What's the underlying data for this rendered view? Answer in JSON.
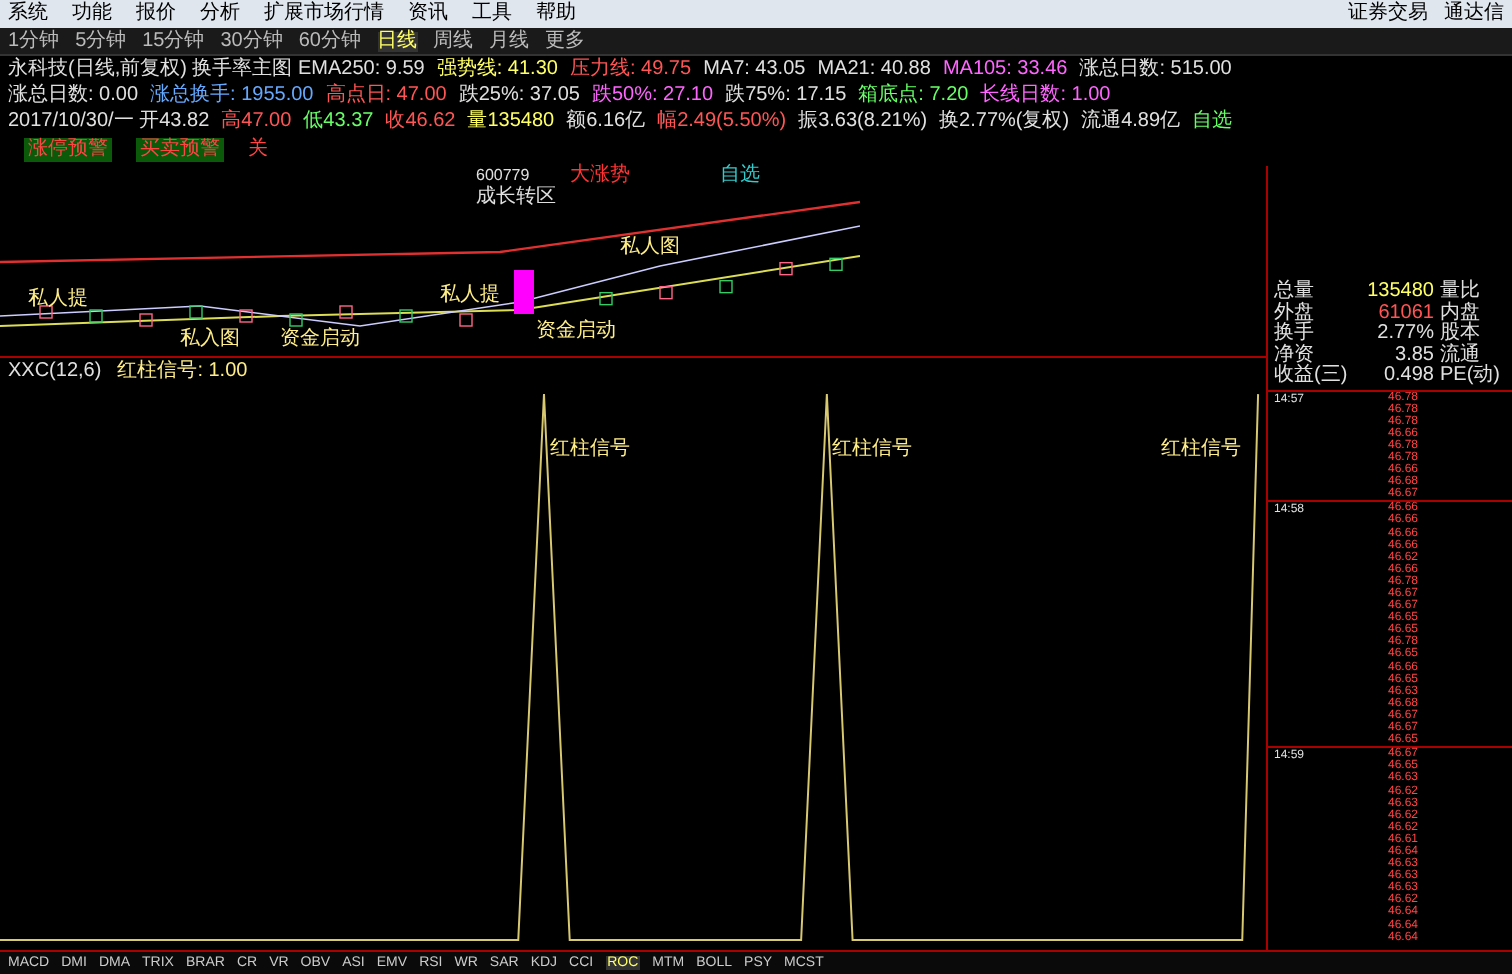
{
  "menu": {
    "items": [
      "系统",
      "功能",
      "报价",
      "分析",
      "扩展市场行情",
      "资讯",
      "工具",
      "帮助"
    ],
    "right": [
      "证券交易",
      "通达信"
    ]
  },
  "periods": [
    {
      "label": "1分钟",
      "selected": false
    },
    {
      "label": "5分钟",
      "selected": false
    },
    {
      "label": "15分钟",
      "selected": false
    },
    {
      "label": "30分钟",
      "selected": false
    },
    {
      "label": "60分钟",
      "selected": false
    },
    {
      "label": "日线",
      "selected": true
    },
    {
      "label": "周线",
      "selected": false
    },
    {
      "label": "月线",
      "selected": false
    },
    {
      "label": "更多",
      "selected": false
    }
  ],
  "info_lines": [
    [
      {
        "text": "永科技(日线,前复权) 换手率主图 EMA250: 9.59",
        "color": "#e0e0e0"
      },
      {
        "text": "强势线: 41.30",
        "color": "#ffff66"
      },
      {
        "text": "压力线: 49.75",
        "color": "#ff5555"
      },
      {
        "text": "MA7: 43.05",
        "color": "#e0e0e0"
      },
      {
        "text": "MA21: 40.88",
        "color": "#e0e0e0"
      },
      {
        "text": "MA105: 33.46",
        "color": "#ff66ff"
      },
      {
        "text": "涨总日数: 515.00",
        "color": "#e0e0e0"
      }
    ],
    [
      {
        "text": "涨总日数: 0.00",
        "color": "#e0e0e0"
      },
      {
        "text": "涨总换手: 1955.00",
        "color": "#66aaff"
      },
      {
        "text": "高点日: 47.00",
        "color": "#ff5555"
      },
      {
        "text": "跌25%: 37.05",
        "color": "#e0e0e0"
      },
      {
        "text": "跌50%: 27.10",
        "color": "#ff66ff"
      },
      {
        "text": "跌75%: 17.15",
        "color": "#e0e0e0"
      },
      {
        "text": "箱底点: 7.20",
        "color": "#66ff66"
      },
      {
        "text": "长线日数: 1.00",
        "color": "#ff66ff"
      }
    ],
    [
      {
        "text": "2017/10/30/一 开43.82",
        "color": "#e0e0e0"
      },
      {
        "text": "高47.00",
        "color": "#ff5555"
      },
      {
        "text": "低43.37",
        "color": "#66ff66"
      },
      {
        "text": "收46.62",
        "color": "#ff5555"
      },
      {
        "text": "量135480",
        "color": "#ffff66"
      },
      {
        "text": "额6.16亿",
        "color": "#e0e0e0"
      },
      {
        "text": "幅2.49(5.50%)",
        "color": "#ff5555"
      },
      {
        "text": "振3.63(8.21%)",
        "color": "#e0e0e0"
      },
      {
        "text": "换2.77%(复权)",
        "color": "#e0e0e0"
      },
      {
        "text": "流通4.89亿",
        "color": "#e0e0e0"
      },
      {
        "text": "自选",
        "color": "#66ff66"
      }
    ]
  ],
  "signal_buttons": [
    "涨停预警",
    "买卖预警",
    "关"
  ],
  "chart_labels": {
    "code": "600779",
    "trend": "大涨势",
    "watch": "自选",
    "zone": "成长转区"
  },
  "candle_notes": [
    "私人提",
    "私入图",
    "资金启动",
    "私人提",
    "资金启动",
    "私人图"
  ],
  "indicator": {
    "title": "XXC(12,6)",
    "signal": "红柱信号: 1.00",
    "peaks": [
      "红柱信号",
      "红柱信号",
      "红柱信号"
    ]
  },
  "stats": [
    {
      "label": "总量",
      "value": "135480",
      "extra": "量比"
    },
    {
      "label": "外盘",
      "value": "61061",
      "extra": "内盘"
    },
    {
      "label": "换手",
      "value": "2.77%",
      "extra": "股本"
    },
    {
      "label": "净资",
      "value": "3.85",
      "extra": "流通"
    },
    {
      "label": "收益(三)",
      "value": "0.498",
      "extra": "PE(动)"
    }
  ],
  "ticks": [
    {
      "time": "14:57",
      "prices": [
        "46.78",
        "46.78",
        "46.78",
        "46.66",
        "46.78",
        "46.78",
        "46.66",
        "46.68",
        "46.67"
      ]
    },
    {
      "time": "14:58",
      "prices": [
        "46.66",
        "46.66",
        "46.66",
        "46.66",
        "46.62",
        "46.66",
        "46.78",
        "46.67",
        "46.67",
        "46.65",
        "46.65",
        "46.78",
        "46.65",
        "46.66",
        "46.65",
        "46.63",
        "46.68",
        "46.67",
        "46.67",
        "46.65"
      ]
    },
    {
      "time": "14:59",
      "prices": [
        "46.67",
        "46.65",
        "46.63",
        "46.62",
        "46.63",
        "46.62",
        "46.62",
        "46.61",
        "46.64",
        "46.63",
        "46.63",
        "46.63",
        "46.62",
        "46.64",
        "46.64",
        "46.64"
      ]
    }
  ],
  "indicator_tabs": [
    {
      "label": "MACD",
      "selected": false
    },
    {
      "label": "DMI",
      "selected": false
    },
    {
      "label": "DMA",
      "selected": false
    },
    {
      "label": "TRIX",
      "selected": false
    },
    {
      "label": "BRAR",
      "selected": false
    },
    {
      "label": "CR",
      "selected": false
    },
    {
      "label": "VR",
      "selected": false
    },
    {
      "label": "OBV",
      "selected": false
    },
    {
      "label": "ASI",
      "selected": false
    },
    {
      "label": "EMV",
      "selected": false
    },
    {
      "label": "RSI",
      "selected": false
    },
    {
      "label": "WR",
      "selected": false
    },
    {
      "label": "SAR",
      "selected": false
    },
    {
      "label": "KDJ",
      "selected": false
    },
    {
      "label": "CCI",
      "selected": false
    },
    {
      "label": "ROC",
      "selected": true
    },
    {
      "label": "MTM",
      "selected": false
    },
    {
      "label": "BOLL",
      "selected": false
    },
    {
      "label": "PSY",
      "selected": false
    },
    {
      "label": "MCST",
      "selected": false
    }
  ]
}
